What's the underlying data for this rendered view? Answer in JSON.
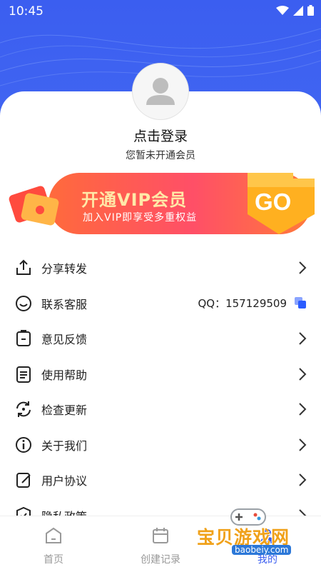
{
  "status": {
    "time": "10:45"
  },
  "profile": {
    "login_label": "点击登录",
    "member_status": "您暂未开通会员"
  },
  "banner": {
    "title": "开通VIP会员",
    "subtitle": "加入VIP即享受多重权益",
    "go_label": "GO"
  },
  "menu": [
    {
      "label": "分享转发",
      "icon": "share-icon"
    },
    {
      "label": "联系客服",
      "icon": "chat-icon",
      "extra": "QQ：157129509"
    },
    {
      "label": "意见反馈",
      "icon": "feedback-icon"
    },
    {
      "label": "使用帮助",
      "icon": "clipboard-icon"
    },
    {
      "label": "检查更新",
      "icon": "refresh-icon"
    },
    {
      "label": "关于我们",
      "icon": "info-icon"
    },
    {
      "label": "用户协议",
      "icon": "edit-doc-icon"
    },
    {
      "label": "隐私政策",
      "icon": "shield-icon"
    }
  ],
  "tabs": [
    {
      "label": "首页",
      "icon": "home-icon"
    },
    {
      "label": "创建记录",
      "icon": "calendar-icon"
    },
    {
      "label": "我的",
      "icon": "user-icon"
    }
  ],
  "watermark": {
    "brand": "宝贝游戏网",
    "domain": "baobeiy.com"
  },
  "colors": {
    "primary": "#3b5ef0",
    "banner": "#ff5a55",
    "accent": "#2b5cff"
  }
}
